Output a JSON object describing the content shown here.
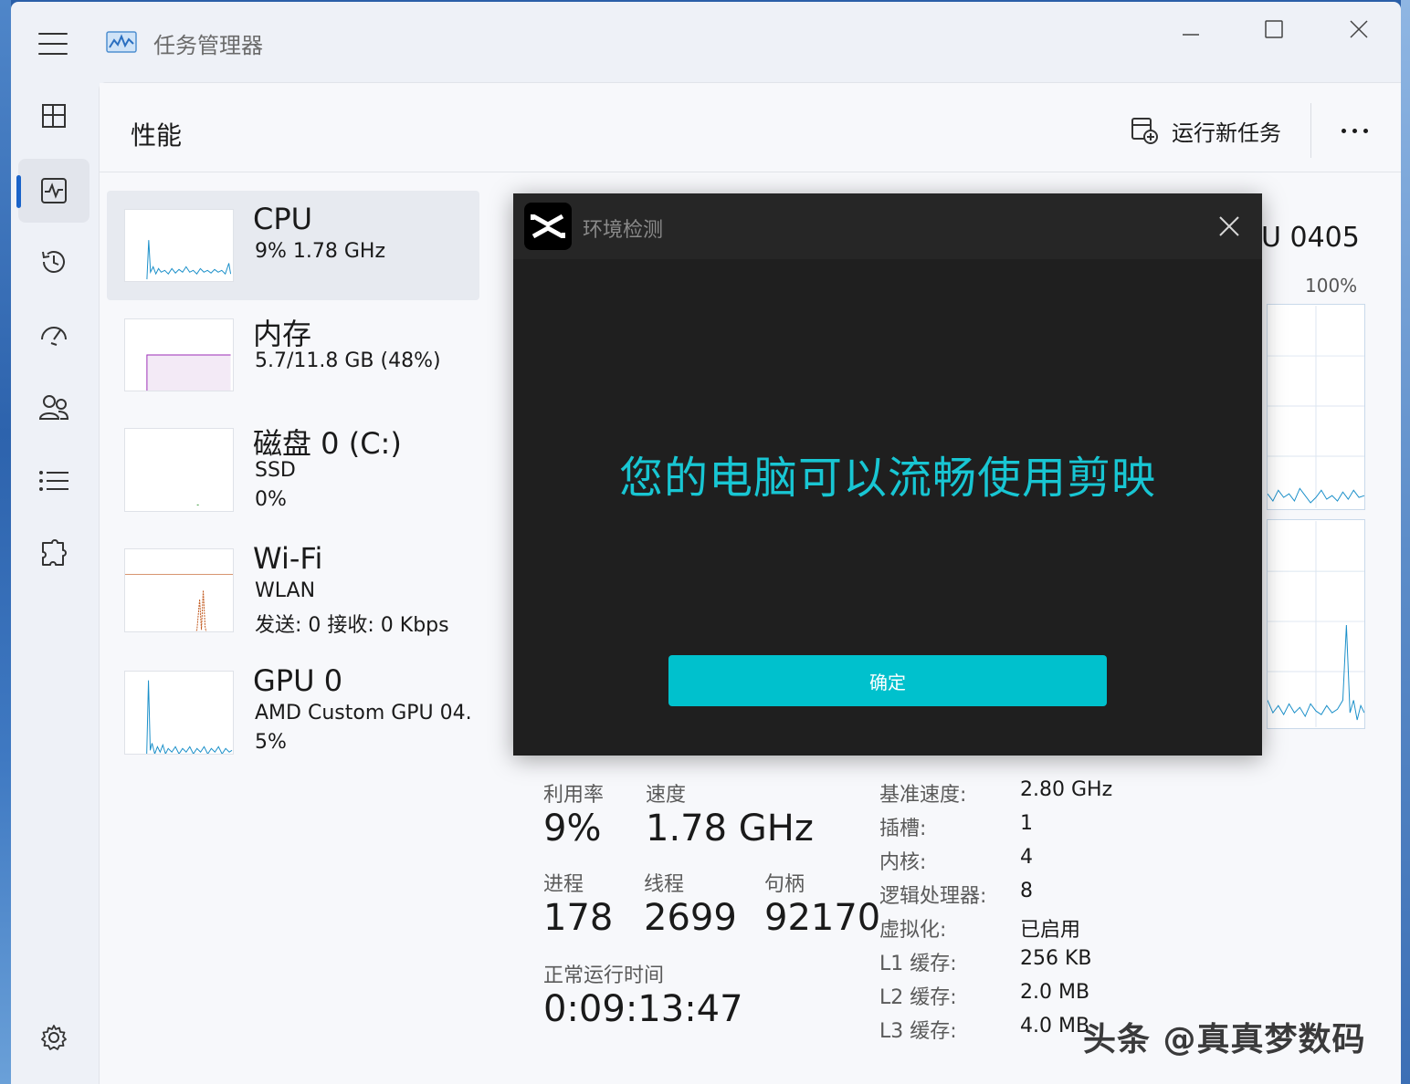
{
  "app": {
    "title": "任务管理器",
    "page_title": "性能",
    "run_task_label": "运行新任务"
  },
  "perf_list": [
    {
      "name": "CPU",
      "sub1": "9%  1.78 GHz"
    },
    {
      "name": "内存",
      "sub1": "5.7/11.8 GB (48%)"
    },
    {
      "name": "磁盘 0 (C:)",
      "sub1": "SSD",
      "sub2": "0%"
    },
    {
      "name": "Wi-Fi",
      "sub1": "WLAN",
      "sub2": "发送: 0  接收: 0 Kbps"
    },
    {
      "name": "GPU 0",
      "sub1": "AMD Custom GPU 04.",
      "sub2": "5%"
    }
  ],
  "cpu_panel": {
    "model_fragment": "U 0405",
    "graph_max": "100%"
  },
  "stats": {
    "utilization_label": "利用率",
    "utilization_value": "9%",
    "speed_label": "速度",
    "speed_value": "1.78 GHz",
    "processes_label": "进程",
    "processes_value": "178",
    "threads_label": "线程",
    "threads_value": "2699",
    "handles_label": "句柄",
    "handles_value": "92170",
    "uptime_label": "正常运行时间",
    "uptime_value": "0:09:13:47"
  },
  "specs": [
    {
      "label": "基准速度:",
      "value": "2.80 GHz"
    },
    {
      "label": "插槽:",
      "value": "1"
    },
    {
      "label": "内核:",
      "value": "4"
    },
    {
      "label": "逻辑处理器:",
      "value": "8"
    },
    {
      "label": "虚拟化:",
      "value": "已启用"
    },
    {
      "label": "L1 缓存:",
      "value": "256 KB"
    },
    {
      "label": "L2 缓存:",
      "value": "2.0 MB"
    },
    {
      "label": "L3 缓存:",
      "value": "4.0 MB"
    }
  ],
  "modal": {
    "title": "环境检测",
    "message": "您的电脑可以流畅使用剪映",
    "ok_label": "确定"
  },
  "watermark": "头条 @真真梦数码",
  "colors": {
    "accent": "#1a63c9",
    "modal_bg": "#1f1f1f",
    "modal_text": "#18c6d3",
    "modal_button": "#00c1cd",
    "cpu_graph": "#1a8fc9",
    "memory_graph": "#9b2bb5",
    "wifi_graph": "#c0561a"
  }
}
